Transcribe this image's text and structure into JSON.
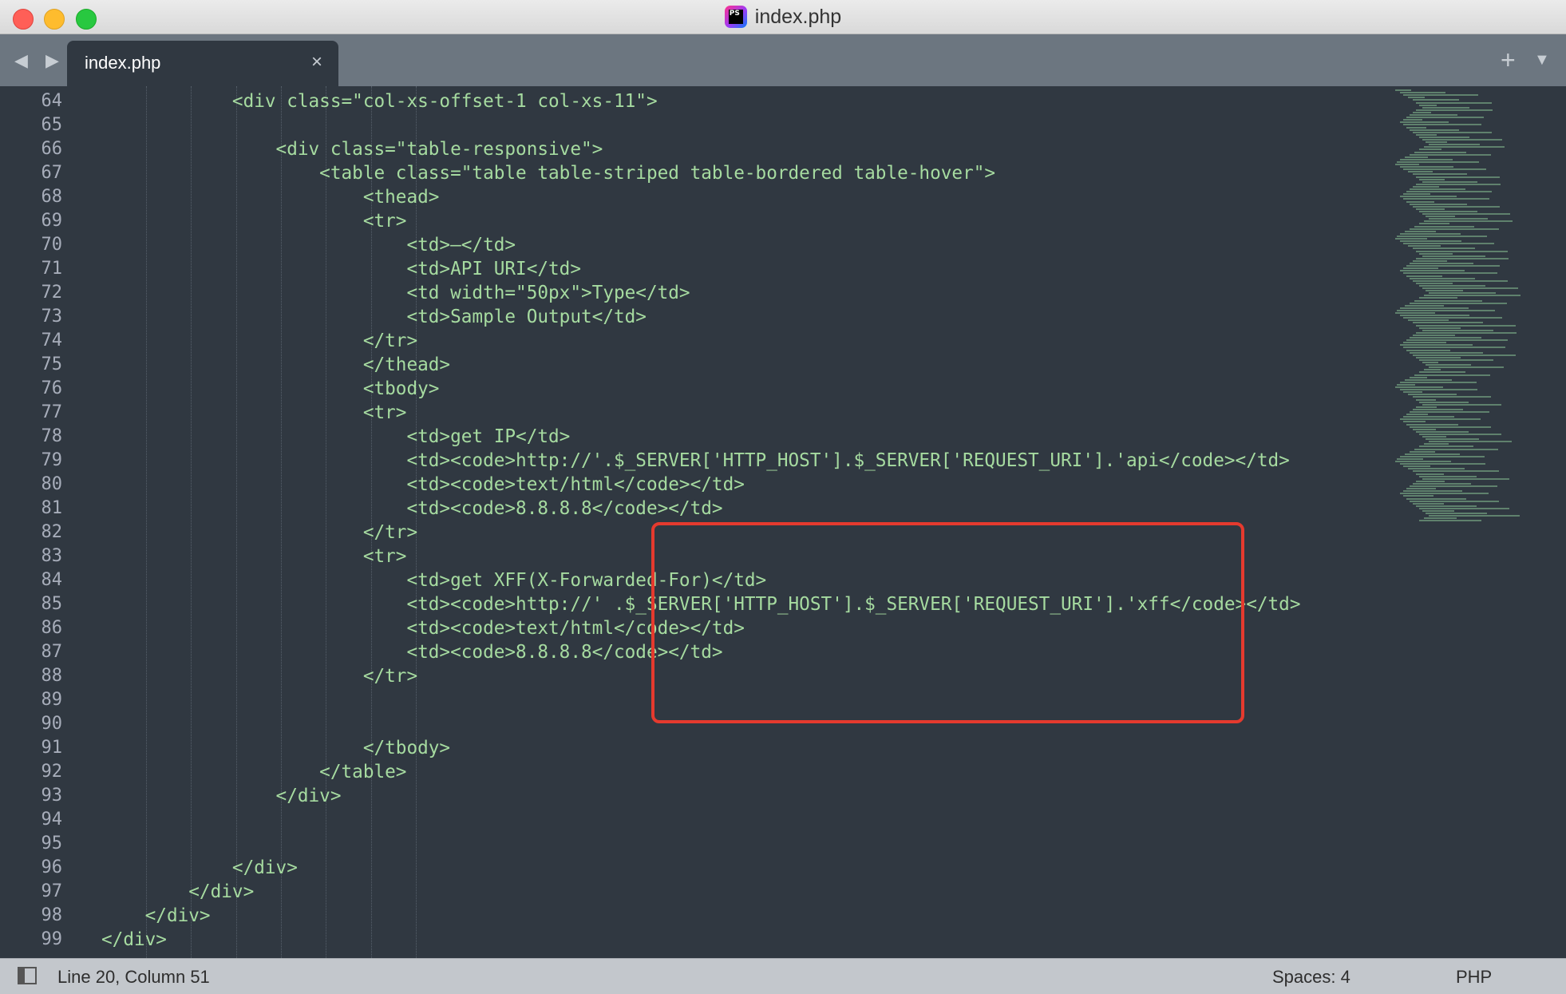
{
  "window": {
    "title": "index.php"
  },
  "tabs": [
    {
      "label": "index.php",
      "close": "×"
    }
  ],
  "tabbar": {
    "nav": "◀ ▶",
    "new_tab": "+",
    "menu": "▼"
  },
  "editor": {
    "line_numbers": [
      "64",
      "65",
      "66",
      "67",
      "68",
      "69",
      "70",
      "71",
      "72",
      "73",
      "74",
      "75",
      "76",
      "77",
      "78",
      "79",
      "80",
      "81",
      "82",
      "83",
      "84",
      "85",
      "86",
      "87",
      "88",
      "89",
      "90",
      "91",
      "92",
      "93",
      "94",
      "95",
      "96",
      "97",
      "98",
      "99"
    ],
    "lines": [
      "            <div class=\"col-xs-offset-1 col-xs-11\">",
      "",
      "                <div class=\"table-responsive\">",
      "                    <table class=\"table table-striped table-bordered table-hover\">",
      "                        <thead>",
      "                        <tr>",
      "                            <td>—</td>",
      "                            <td>API URI</td>",
      "                            <td width=\"50px\">Type</td>",
      "                            <td>Sample Output</td>",
      "                        </tr>",
      "                        </thead>",
      "                        <tbody>",
      "                        <tr>",
      "                            <td>get IP</td>",
      "                            <td><code>http://'.$_SERVER['HTTP_HOST'].$_SERVER['REQUEST_URI'].'api</code></td>",
      "                            <td><code>text/html</code></td>",
      "                            <td><code>8.8.8.8</code></td>",
      "                        </tr>",
      "                        <tr>",
      "                            <td>get XFF(X-Forwarded-For)</td>",
      "                            <td><code>http://' .$_SERVER['HTTP_HOST'].$_SERVER['REQUEST_URI'].'xff</code></td>",
      "                            <td><code>text/html</code></td>",
      "                            <td><code>8.8.8.8</code></td>",
      "                        </tr>",
      "",
      "",
      "                        </tbody>",
      "                    </table>",
      "                </div>",
      "",
      "",
      "            </div>",
      "        </div>",
      "    </div>",
      "</div>"
    ]
  },
  "statusbar": {
    "position": "Line 20, Column 51",
    "indentation": "Spaces: 4",
    "syntax": "PHP"
  },
  "colors": {
    "background": "#303841",
    "code_text": "#a6dba0",
    "highlight_box": "#e53a2e"
  }
}
